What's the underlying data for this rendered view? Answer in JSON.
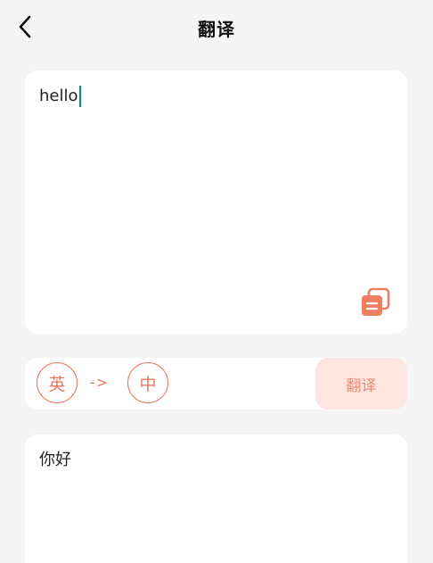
{
  "header": {
    "title": "翻译",
    "back_icon": "chevron-left-icon"
  },
  "source": {
    "text": "hello",
    "copy_icon": "copy-icon"
  },
  "language": {
    "from": "英",
    "arrow": "->",
    "to": "中",
    "translate_label": "翻译"
  },
  "result": {
    "text": "你好"
  },
  "colors": {
    "accent": "#e8785e",
    "button_bg": "#fde6e0",
    "caret": "#12887a",
    "background": "#f5f5f5",
    "card": "#ffffff"
  }
}
